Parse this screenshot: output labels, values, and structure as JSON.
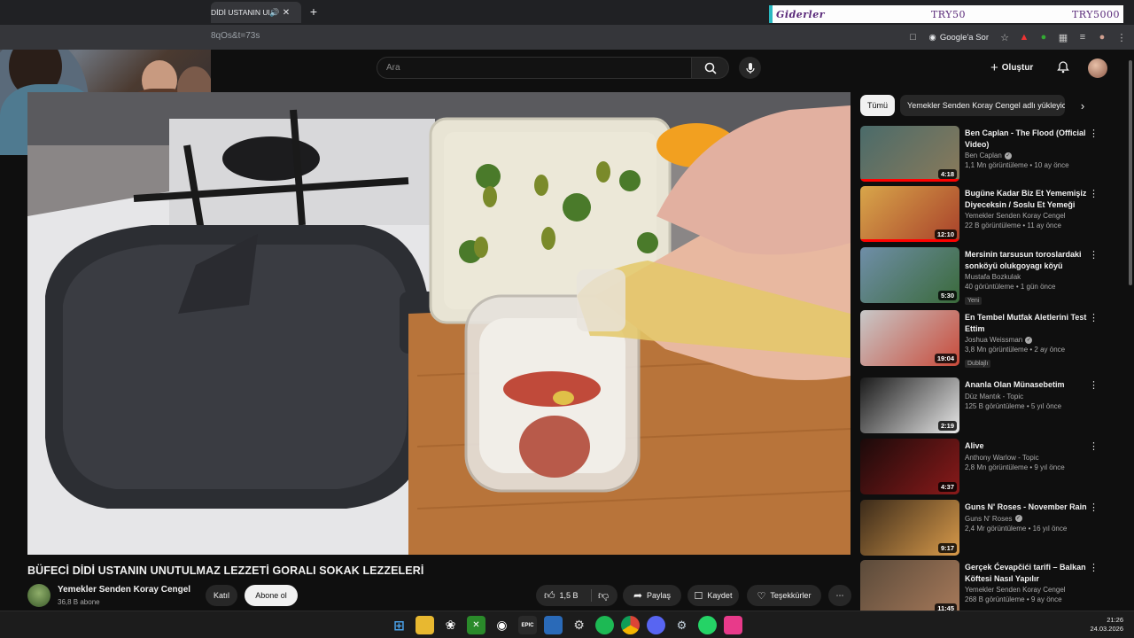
{
  "browser": {
    "tab_title": "DİDİ USTANIN UNUTU",
    "url": "8qOs&t=73s",
    "google_sor": "Google'a Sor"
  },
  "overlay": {
    "left": "Giderler",
    "mid": "TRY50",
    "right": "TRY5000"
  },
  "header": {
    "search_placeholder": "Ara",
    "create_label": "Oluştur"
  },
  "video": {
    "title": "BÜFECİ DİDİ USTANIN UNUTULMAZ LEZZETİ GORALI SOKAK LEZZELERİ",
    "channel": "Yemekler Senden Koray Cengel",
    "subs": "36,8 B abone",
    "join": "Katıl",
    "subscribe": "Abone ol",
    "likes": "1,5 B",
    "share": "Paylaş",
    "save": "Kaydet",
    "thanks": "Teşekkürler"
  },
  "sidebar": {
    "chips": [
      "Tümü",
      "Yemekler Senden Koray Cengel adlı yükleyici"
    ],
    "items": [
      {
        "title": "Ben Caplan - The Flood (Official Video)",
        "channel": "Ben Caplan",
        "verified": true,
        "meta": "1,1 Mn görüntüleme • 10 ay önce",
        "duration": "4:18",
        "music": true,
        "badge": "",
        "progress": 1.0,
        "colors": [
          "#4a6b6a",
          "#8a7a5a"
        ]
      },
      {
        "title": "Bugüne Kadar Biz Et Yememişiz Diyeceksin / Soslu Et Yemeği",
        "channel": "Yemekler Senden Koray Cengel",
        "verified": false,
        "meta": "22 B görüntüleme • 11 ay önce",
        "duration": "12:10",
        "music": false,
        "badge": "",
        "progress": 1.0,
        "colors": [
          "#d8a64a",
          "#a8402a"
        ]
      },
      {
        "title": "Mersinin tarsusun toroslardaki sonköyü olukgoyagı köyü",
        "channel": "Mustafa Bozkulak",
        "verified": false,
        "meta": "40 görüntüleme • 1 gün önce",
        "duration": "5:30",
        "music": false,
        "badge": "Yeni",
        "progress": 0,
        "colors": [
          "#6f8ea8",
          "#3a6a3a"
        ]
      },
      {
        "title": "En Tembel Mutfak Aletlerini Test Ettim",
        "channel": "Joshua Weissman",
        "verified": true,
        "meta": "3,8 Mn görüntüleme • 2 ay önce",
        "duration": "19:04",
        "music": false,
        "badge": "Dublajlı",
        "progress": 0,
        "colors": [
          "#c8c8c8",
          "#c84a3a"
        ]
      },
      {
        "title": "Ananla Olan Münasebetim",
        "channel": "Düz Mantık - Topic",
        "verified": false,
        "meta": "125 B görüntüleme • 5 yıl önce",
        "duration": "2:19",
        "music": true,
        "badge": "",
        "progress": 0,
        "colors": [
          "#1a1a1a",
          "#e8e8e8"
        ]
      },
      {
        "title": "Alive",
        "channel": "Anthony Warlow - Topic",
        "verified": false,
        "meta": "2,8 Mn görüntüleme • 9 yıl önce",
        "duration": "4:37",
        "music": true,
        "badge": "",
        "progress": 0,
        "colors": [
          "#1a0a0a",
          "#8a1a1a"
        ]
      },
      {
        "title": "Guns N' Roses - November Rain",
        "channel": "Guns N' Roses",
        "verified": true,
        "meta": "2,4 Mr görüntüleme • 16 yıl önce",
        "duration": "9:17",
        "music": true,
        "badge": "",
        "progress": 0,
        "colors": [
          "#3a2a1a",
          "#d89a4a"
        ]
      },
      {
        "title": "Gerçek Ćevapčići tarifi – Balkan Köftesi Nasıl Yapılır",
        "channel": "Yemekler Senden Koray Cengel",
        "verified": false,
        "meta": "268 B görüntüleme • 9 ay önce",
        "duration": "11:45",
        "music": false,
        "badge": "",
        "progress": 0,
        "colors": [
          "#5a4a3a",
          "#a87a5a"
        ]
      }
    ]
  },
  "taskbar": {
    "time": "21:26",
    "date": "24.03.2026"
  }
}
